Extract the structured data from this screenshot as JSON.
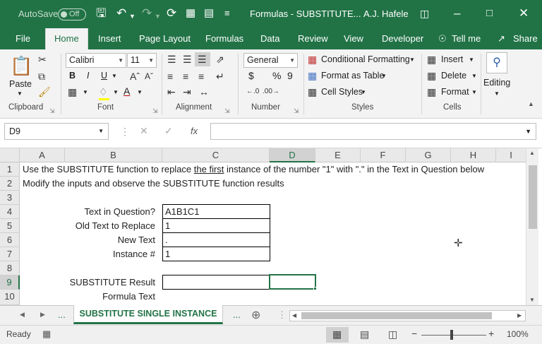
{
  "titlebar": {
    "autosave_label": "AutoSave",
    "autosave_state": "Off",
    "doc_title": "Formulas - SUBSTITUTE...",
    "user": "A.J. Hafele"
  },
  "tabs": [
    "File",
    "Home",
    "Insert",
    "Page Layout",
    "Formulas",
    "Data",
    "Review",
    "View",
    "Developer",
    "Tell me",
    "Share"
  ],
  "ribbon": {
    "clipboard": {
      "label": "Clipboard",
      "paste": "Paste"
    },
    "font": {
      "label": "Font",
      "family": "Calibri",
      "size": "11",
      "bold": "B",
      "italic": "I",
      "underline": "U"
    },
    "alignment": {
      "label": "Alignment"
    },
    "number": {
      "label": "Number",
      "format": "General",
      "currency": "$",
      "percent": "%",
      "comma": "9"
    },
    "styles": {
      "label": "Styles",
      "conditional": "Conditional Formatting",
      "table": "Format as Table",
      "cell_styles": "Cell Styles"
    },
    "cells": {
      "label": "Cells",
      "insert": "Insert",
      "delete": "Delete",
      "format": "Format"
    },
    "editing": {
      "label": "Editing"
    }
  },
  "formula_bar": {
    "name_box": "D9",
    "formula": ""
  },
  "columns": [
    "A",
    "B",
    "C",
    "D",
    "E",
    "F",
    "G",
    "H",
    "I"
  ],
  "rows": [
    "1",
    "2",
    "3",
    "4",
    "5",
    "6",
    "7",
    "8",
    "9",
    "10"
  ],
  "cells": {
    "r1_a": "Use the SUBSTITUTE function to replace",
    "r1_u": "the first",
    "r1_b": "instance of the number \"1\" with \".\" in the Text in Question below",
    "r2": "Modify the inputs and observe the SUBSTITUTE function results",
    "r4_label": "Text in Question?",
    "r4_value": "A1B1C1",
    "r5_label": "Old Text to Replace",
    "r5_value": "1",
    "r6_label": "New Text",
    "r6_value": ".",
    "r7_label": "Instance #",
    "r7_value": "1",
    "r9_label": "SUBSTITUTE Result",
    "r9_value": "",
    "r10_label": "Formula Text"
  },
  "sheet_tabs": {
    "active": "SUBSTITUTE SINGLE INSTANCE",
    "more_left": "...",
    "more_right": "..."
  },
  "status": {
    "ready": "Ready",
    "zoom": "100%"
  }
}
